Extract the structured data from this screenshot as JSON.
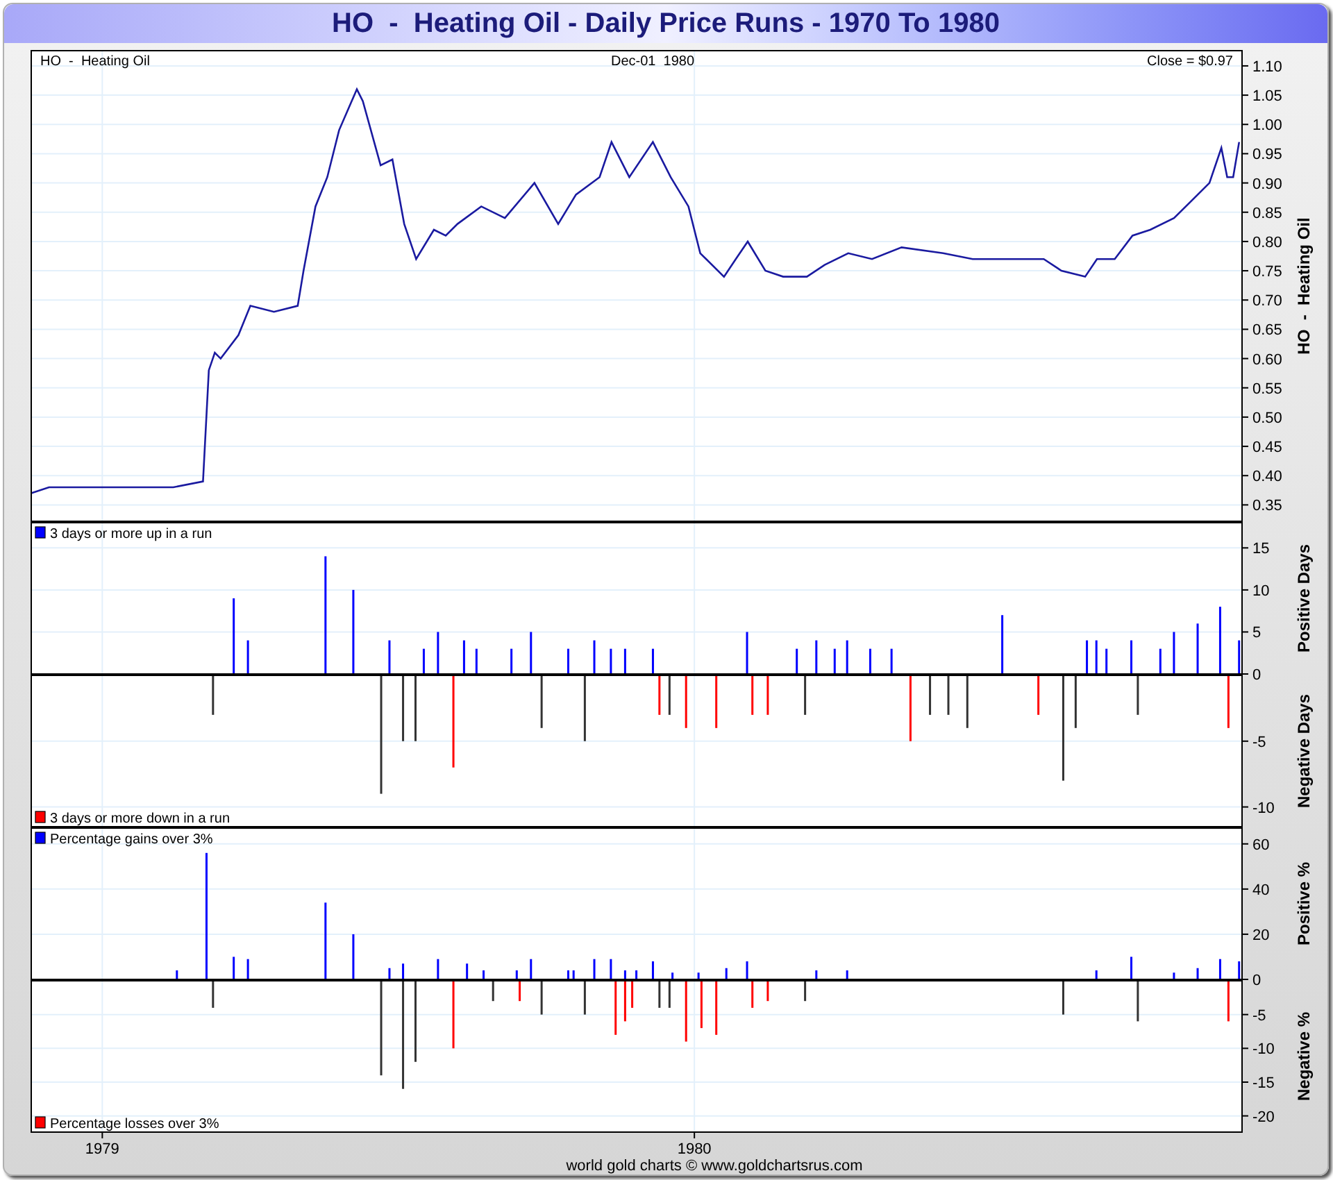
{
  "title": "HO  -  Heating Oil - Daily Price Runs - 1970 To 1980",
  "price_panel": {
    "symbol_label": "HO  -  Heating Oil",
    "date": "Dec-01  1980",
    "close": "Close = $0.97",
    "chart_data": {
      "type": "line",
      "grid": true,
      "ylabel": "HO  -  Heating Oil",
      "xlim": [
        1978.88,
        1980.925
      ],
      "ylim": [
        0.322,
        1.126
      ],
      "yticks": [
        {
          "value": 1.1,
          "label": "1.10"
        },
        {
          "value": 1.05,
          "label": "1.05"
        },
        {
          "value": 1.0,
          "label": "1.00"
        },
        {
          "value": 0.95,
          "label": "0.95"
        },
        {
          "value": 0.9,
          "label": "0.90"
        },
        {
          "value": 0.85,
          "label": "0.85"
        },
        {
          "value": 0.8,
          "label": "0.80"
        },
        {
          "value": 0.75,
          "label": "0.75"
        },
        {
          "value": 0.7,
          "label": "0.70"
        },
        {
          "value": 0.65,
          "label": "0.65"
        },
        {
          "value": 0.6,
          "label": "0.60"
        },
        {
          "value": 0.55,
          "label": "0.55"
        },
        {
          "value": 0.5,
          "label": "0.50"
        },
        {
          "value": 0.45,
          "label": "0.45"
        },
        {
          "value": 0.4,
          "label": "0.40"
        },
        {
          "value": 0.35,
          "label": "0.35"
        }
      ],
      "x": [
        1978.88,
        1978.91,
        1979.12,
        1979.17,
        1979.18,
        1979.19,
        1979.2,
        1979.23,
        1979.25,
        1979.29,
        1979.33,
        1979.34,
        1979.36,
        1979.38,
        1979.4,
        1979.43,
        1979.44,
        1979.47,
        1979.49,
        1979.51,
        1979.53,
        1979.56,
        1979.58,
        1979.6,
        1979.64,
        1979.68,
        1979.73,
        1979.77,
        1979.8,
        1979.84,
        1979.86,
        1979.89,
        1979.93,
        1979.96,
        1979.99,
        1980.01,
        1980.05,
        1980.07,
        1980.09,
        1980.12,
        1980.15,
        1980.19,
        1980.22,
        1980.26,
        1980.3,
        1980.35,
        1980.42,
        1980.47,
        1980.54,
        1980.59,
        1980.62,
        1980.66,
        1980.68,
        1980.71,
        1980.74,
        1980.77,
        1980.81,
        1980.84,
        1980.87,
        1980.89,
        1980.9,
        1980.91,
        1980.92
      ],
      "series": [
        {
          "color": "#1a1aa0",
          "values": [
            0.37,
            0.38,
            0.38,
            0.39,
            0.58,
            0.61,
            0.6,
            0.64,
            0.69,
            0.68,
            0.69,
            0.75,
            0.86,
            0.91,
            0.99,
            1.06,
            1.04,
            0.93,
            0.94,
            0.83,
            0.77,
            0.82,
            0.81,
            0.83,
            0.86,
            0.84,
            0.9,
            0.83,
            0.88,
            0.91,
            0.97,
            0.91,
            0.97,
            0.91,
            0.86,
            0.78,
            0.74,
            0.77,
            0.8,
            0.75,
            0.74,
            0.74,
            0.76,
            0.78,
            0.77,
            0.79,
            0.78,
            0.77,
            0.77,
            0.77,
            0.75,
            0.74,
            0.77,
            0.77,
            0.81,
            0.82,
            0.84,
            0.87,
            0.9,
            0.96,
            0.91,
            0.91,
            0.97
          ]
        }
      ]
    }
  },
  "runs_panel": {
    "upper": {
      "axis_label": "Positive Days",
      "chart_data": {
        "type": "bar",
        "grid": true,
        "xlim": [
          1978.88,
          1980.925
        ],
        "ylim": [
          0,
          18
        ],
        "yticks": [
          {
            "value": 15,
            "label": "15"
          },
          {
            "value": 10,
            "label": "10"
          },
          {
            "value": 5,
            "label": "5"
          },
          {
            "value": 0,
            "label": "0"
          }
        ],
        "x": [
          1979.222,
          1979.246,
          1979.377,
          1979.424,
          1979.485,
          1979.543,
          1979.567,
          1979.611,
          1979.632,
          1979.691,
          1979.724,
          1979.787,
          1979.831,
          1979.859,
          1979.883,
          1979.93,
          1980.089,
          1980.173,
          1980.206,
          1980.237,
          1980.258,
          1980.297,
          1980.333,
          1980.52,
          1980.663,
          1980.679,
          1980.696,
          1980.738,
          1980.787,
          1980.81,
          1980.85,
          1980.888,
          1980.92
        ],
        "series": [
          {
            "name": "3 days or more up in a run",
            "color": "#0000ff",
            "values": [
              9,
              4,
              14,
              10,
              4,
              3,
              5,
              4,
              3,
              3,
              5,
              3,
              4,
              3,
              3,
              3,
              5,
              3,
              4,
              3,
              4,
              3,
              3,
              7,
              4,
              4,
              3,
              4,
              3,
              5,
              6,
              8,
              4
            ]
          }
        ]
      }
    },
    "lower": {
      "axis_label": "Negative Days",
      "chart_data": {
        "type": "bar",
        "grid": true,
        "xlim": [
          1978.88,
          1980.925
        ],
        "ylim": [
          -11.5,
          0
        ],
        "yticks": [
          {
            "value": -5,
            "label": "-5"
          },
          {
            "value": -10,
            "label": "-10"
          }
        ],
        "x": [
          1979.187,
          1979.471,
          1979.508,
          1979.529,
          1979.593,
          1979.742,
          1979.815,
          1979.941,
          1979.958,
          1979.986,
          1980.037,
          1980.098,
          1980.124,
          1980.187,
          1980.365,
          1980.398,
          1980.429,
          1980.461,
          1980.581,
          1980.623,
          1980.644,
          1980.749,
          1980.902
        ],
        "series": [
          {
            "name": "3 days or more down in a run",
            "color": "#ff0000",
            "values": [
              null,
              null,
              null,
              null,
              -7,
              null,
              null,
              -3,
              null,
              -4,
              -4,
              -3,
              -3,
              null,
              -5,
              null,
              null,
              null,
              -3,
              null,
              null,
              null,
              -4
            ]
          },
          {
            "color": "#333333",
            "values": [
              -3,
              -9,
              -5,
              -5,
              null,
              -4,
              -5,
              null,
              -3,
              null,
              null,
              null,
              null,
              -3,
              null,
              -3,
              -3,
              -4,
              null,
              -8,
              -4,
              -3,
              null
            ]
          }
        ]
      }
    }
  },
  "percent_panel": {
    "upper": {
      "axis_label": "Positive %",
      "chart_data": {
        "type": "bar",
        "grid": true,
        "xlim": [
          1978.88,
          1980.925
        ],
        "ylim": [
          0,
          67
        ],
        "yticks": [
          {
            "value": 60,
            "label": "60"
          },
          {
            "value": 40,
            "label": "40"
          },
          {
            "value": 20,
            "label": "20"
          },
          {
            "value": 0,
            "label": "0"
          }
        ],
        "x": [
          1979.126,
          1979.176,
          1979.222,
          1979.246,
          1979.377,
          1979.424,
          1979.485,
          1979.508,
          1979.567,
          1979.616,
          1979.644,
          1979.7,
          1979.724,
          1979.787,
          1979.796,
          1979.831,
          1979.859,
          1979.883,
          1979.902,
          1979.93,
          1979.963,
          1980.007,
          1980.054,
          1980.089,
          1980.206,
          1980.258,
          1980.679,
          1980.738,
          1980.81,
          1980.85,
          1980.888,
          1980.92
        ],
        "series": [
          {
            "name": "Percentage gains over 3%",
            "color": "#0000ff",
            "values": [
              4,
              56,
              10,
              9,
              34,
              20,
              5,
              7,
              9,
              7,
              4,
              4,
              9,
              4,
              4,
              9,
              9,
              4,
              4,
              8,
              3,
              3,
              5,
              8,
              4,
              4,
              4,
              10,
              3,
              5,
              9,
              8
            ]
          }
        ]
      }
    },
    "lower": {
      "axis_label": "Negative %",
      "chart_data": {
        "type": "bar",
        "grid": true,
        "xlim": [
          1978.88,
          1980.925
        ],
        "ylim": [
          -22.4,
          0
        ],
        "xticks": [
          {
            "value": 1979,
            "label": "1979"
          },
          {
            "value": 1980,
            "label": "1980"
          }
        ],
        "yticks": [
          {
            "value": -5,
            "label": "-5"
          },
          {
            "value": -10,
            "label": "-10"
          },
          {
            "value": -15,
            "label": "-15"
          },
          {
            "value": -20,
            "label": "-20"
          }
        ],
        "x": [
          1979.187,
          1979.471,
          1979.508,
          1979.529,
          1979.593,
          1979.66,
          1979.705,
          1979.742,
          1979.815,
          1979.867,
          1979.883,
          1979.895,
          1979.941,
          1979.958,
          1979.986,
          1980.012,
          1980.037,
          1980.098,
          1980.124,
          1980.187,
          1980.623,
          1980.749,
          1980.902
        ],
        "series": [
          {
            "name": "Percentage losses over 3%",
            "color": "#ff0000",
            "values": [
              null,
              null,
              null,
              null,
              -10,
              null,
              -3,
              null,
              null,
              -8,
              -6,
              -4,
              null,
              null,
              -9,
              -7,
              -8,
              -4,
              -3,
              null,
              null,
              null,
              -6
            ]
          },
          {
            "color": "#333333",
            "values": [
              -4,
              -14,
              -16,
              -12,
              null,
              -3,
              null,
              -5,
              -5,
              null,
              null,
              null,
              -4,
              -4,
              null,
              null,
              null,
              null,
              null,
              -3,
              -5,
              -6,
              null
            ]
          }
        ]
      }
    }
  },
  "footer": "world gold charts © www.goldchartsrus.com"
}
